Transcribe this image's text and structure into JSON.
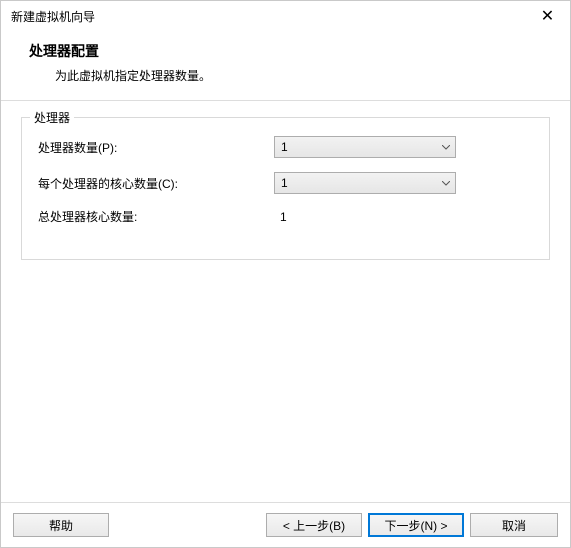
{
  "window": {
    "title": "新建虚拟机向导"
  },
  "header": {
    "title": "处理器配置",
    "subtitle": "为此虚拟机指定处理器数量。"
  },
  "group": {
    "title": "处理器",
    "rows": {
      "processors": {
        "label": "处理器数量(P):",
        "value": "1"
      },
      "cores": {
        "label": "每个处理器的核心数量(C):",
        "value": "1"
      },
      "total": {
        "label": "总处理器核心数量:",
        "value": "1"
      }
    }
  },
  "footer": {
    "help": "帮助",
    "back": "< 上一步(B)",
    "next": "下一步(N) >",
    "cancel": "取消"
  }
}
